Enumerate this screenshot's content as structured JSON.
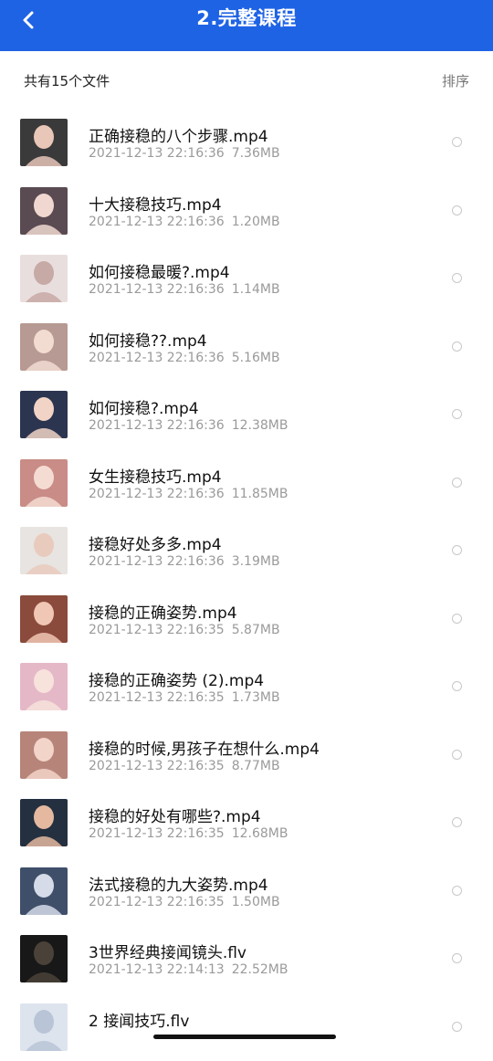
{
  "header": {
    "title": "2.完整课程"
  },
  "toolbar": {
    "file_count": "共有15个文件",
    "sort_label": "排序"
  },
  "colors": {
    "accent": "#1f63e5"
  },
  "files": [
    {
      "name": "正确接稳的八个步骤.mp4",
      "date": "2021-12-13 22:16:36",
      "size": "7.36MB",
      "bg": "#3a3a3a",
      "fg": "#e8c6b8"
    },
    {
      "name": "十大接稳技巧.mp4",
      "date": "2021-12-13 22:16:36",
      "size": "1.20MB",
      "bg": "#5a4a52",
      "fg": "#f0d8d0"
    },
    {
      "name": "如何接稳最暖?.mp4",
      "date": "2021-12-13 22:16:36",
      "size": "1.14MB",
      "bg": "#e9dede",
      "fg": "#c7a9a6"
    },
    {
      "name": "如何接稳??.mp4",
      "date": "2021-12-13 22:16:36",
      "size": "5.16MB",
      "bg": "#b79a93",
      "fg": "#f2dcd2"
    },
    {
      "name": "如何接稳?.mp4",
      "date": "2021-12-13 22:16:36",
      "size": "12.38MB",
      "bg": "#2c3550",
      "fg": "#f1d4c6"
    },
    {
      "name": "女生接稳技巧.mp4",
      "date": "2021-12-13 22:16:36",
      "size": "11.85MB",
      "bg": "#c98c86",
      "fg": "#f5dcd2"
    },
    {
      "name": "接稳好处多多.mp4",
      "date": "2021-12-13 22:16:36",
      "size": "3.19MB",
      "bg": "#e7e4e1",
      "fg": "#e9cbbd"
    },
    {
      "name": "接稳的正确姿势.mp4",
      "date": "2021-12-13 22:16:35",
      "size": "5.87MB",
      "bg": "#8a4a3c",
      "fg": "#f0c7b4"
    },
    {
      "name": "接稳的正确姿势 (2).mp4",
      "date": "2021-12-13 22:16:35",
      "size": "1.73MB",
      "bg": "#e5b8c8",
      "fg": "#f7e2dc"
    },
    {
      "name": "接稳的时候,男孩子在想什么.mp4",
      "date": "2021-12-13 22:16:35",
      "size": "8.77MB",
      "bg": "#b7847a",
      "fg": "#f3d4c8"
    },
    {
      "name": "接稳的好处有哪些?.mp4",
      "date": "2021-12-13 22:16:35",
      "size": "12.68MB",
      "bg": "#24303f",
      "fg": "#e4b9a0"
    },
    {
      "name": "法式接稳的九大姿势.mp4",
      "date": "2021-12-13 22:16:35",
      "size": "1.50MB",
      "bg": "#3f4f6a",
      "fg": "#d5dbe8"
    },
    {
      "name": "3世界经典接闻镜头.flv",
      "date": "2021-12-13 22:14:13",
      "size": "22.52MB",
      "bg": "#181818",
      "fg": "#4a4238"
    },
    {
      "name": "2 接闻技巧.flv",
      "date": "",
      "size": "",
      "bg": "#dde4ee",
      "fg": "#b9c4d6"
    }
  ]
}
